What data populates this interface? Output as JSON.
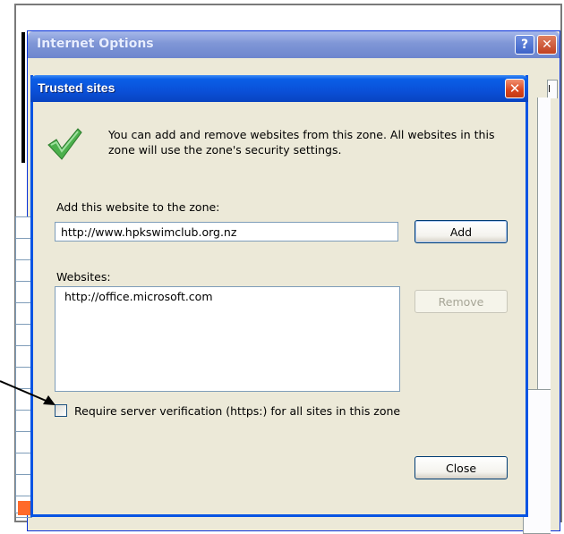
{
  "internet_options": {
    "title": "Internet Options",
    "help_glyph": "?",
    "close_glyph": "✕",
    "tab_fragment": "l"
  },
  "trusted_sites": {
    "title": "Trusted sites",
    "close_glyph": "✕",
    "info_text": "You can add and remove websites from this zone. All websites in this zone will use the zone's security settings.",
    "add_label": "Add this website to the zone:",
    "url_value": "http://www.hpkswimclub.org.nz",
    "add_button": "Add",
    "websites_label": "Websites:",
    "websites": [
      "http://office.microsoft.com"
    ],
    "remove_button": "Remove",
    "https_label": "Require server verification (https:) for all sites in this zone",
    "https_checked": false,
    "close_button": "Close",
    "icon": "green-checkmark-icon"
  },
  "colors": {
    "xp_blue_title": "#0a5ee6",
    "dialog_bg": "#ece9d8",
    "check_green": "#3aa03a"
  }
}
